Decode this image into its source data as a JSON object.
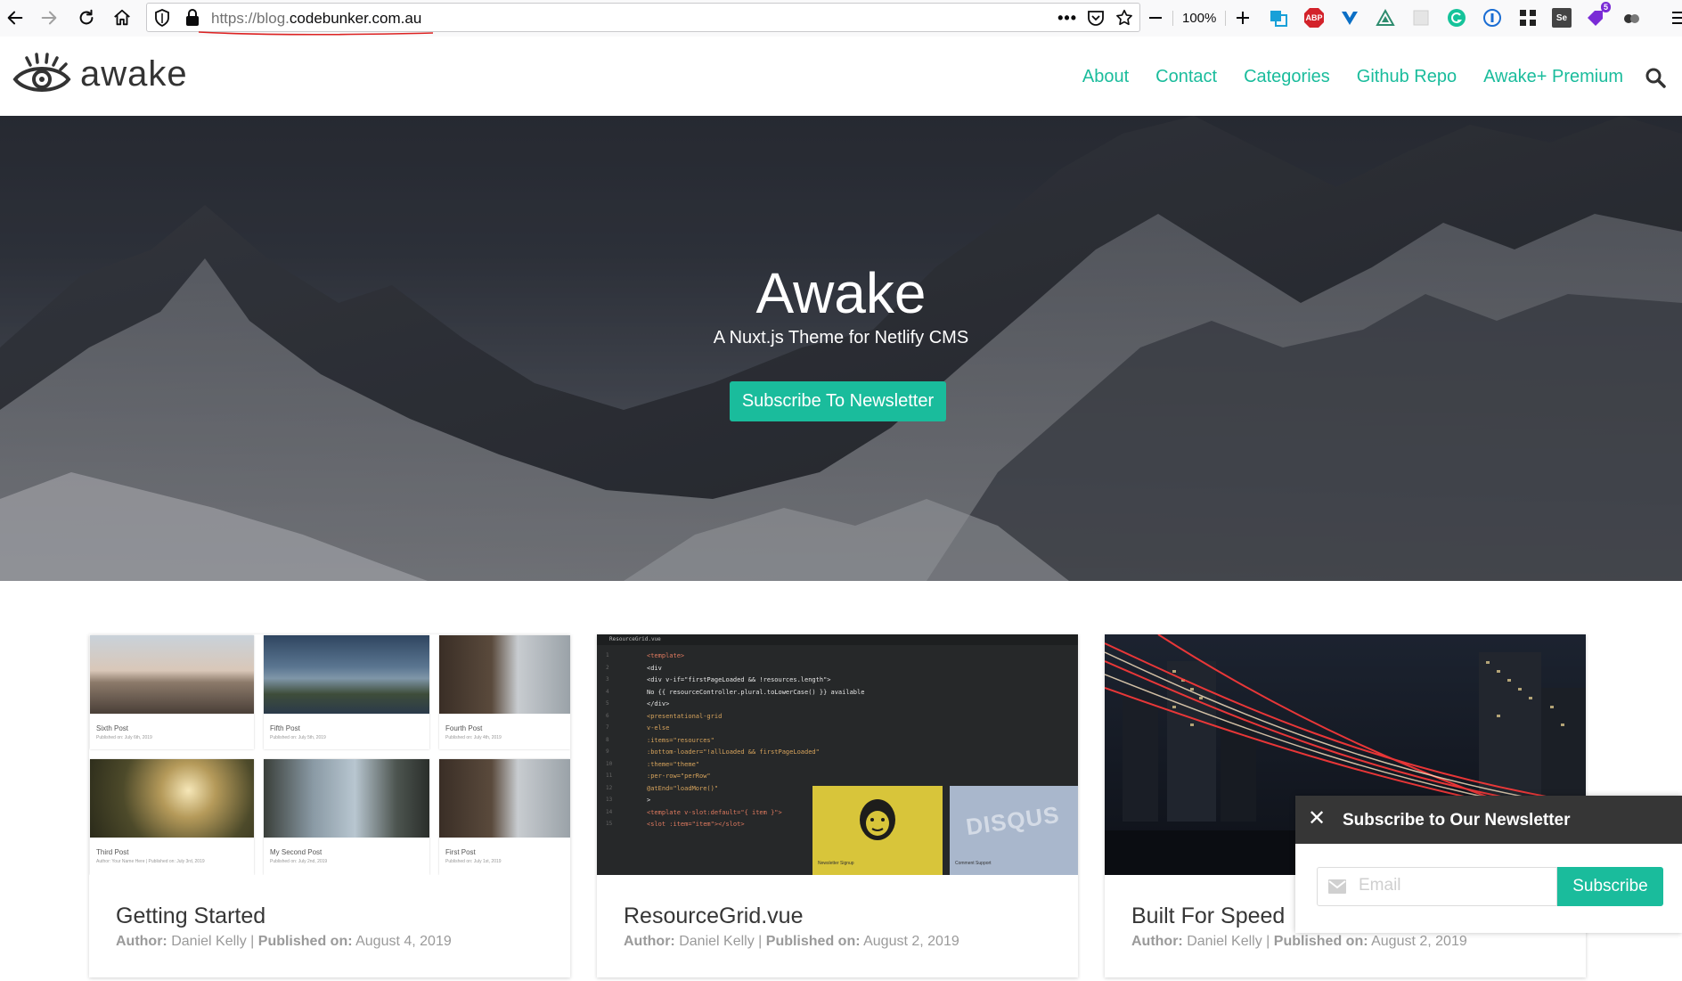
{
  "browser": {
    "url_protocol": "https://",
    "url_host_prefix": "blog.",
    "url_domain": "codebunker.com.au",
    "zoom": "100%",
    "ext_abp": "ABP",
    "ext_badge": "5",
    "ext_se": "Se"
  },
  "site": {
    "logo_text": "awake",
    "nav": [
      "About",
      "Contact",
      "Categories",
      "Github Repo",
      "Awake+ Premium"
    ]
  },
  "hero": {
    "title": "Awake",
    "subtitle": "A Nuxt.js Theme for Netlify CMS",
    "button": "Subscribe To Newsletter"
  },
  "cards": [
    {
      "title": "Getting Started",
      "author_label": "Author:",
      "author": "Daniel Kelly",
      "sep": "|",
      "published_label": "Published on:",
      "date": "August 4, 2019",
      "thumbs": [
        {
          "title": "Sixth Post",
          "meta": "Published on: July 6th, 2019"
        },
        {
          "title": "Fifth Post",
          "meta": "Published on: July 5th, 2019"
        },
        {
          "title": "Fourth Post",
          "meta": "Published on: July 4th, 2019"
        },
        {
          "title": "Third Post",
          "meta": "Author: Your Name Here | Published on: July 3rd, 2019"
        },
        {
          "title": "My Second Post",
          "meta": "Published on: July 2nd, 2019"
        },
        {
          "title": "First Post",
          "meta": "Published on: July 1st, 2019"
        }
      ]
    },
    {
      "title": "ResourceGrid.vue",
      "author_label": "Author:",
      "author": "Daniel Kelly",
      "sep": "|",
      "published_label": "Published on:",
      "date": "August 2, 2019",
      "editor_tab": "ResourceGrid.vue",
      "code_lines": [
        "<template>",
        "  <div",
        "    <div v-if=\"firstPageLoaded && !resources.length\">",
        "      No {{ resourceController.plural.toLowerCase() }} available",
        "    </div>",
        "    <presentational-grid",
        "      v-else",
        "      :items=\"resources\"",
        "      :bottom-loader=\"!allLoaded && firstPageLoaded\"",
        "      :theme=\"theme\"",
        "      :per-row=\"perRow\"",
        "      @atEnd=\"loadMore()\"",
        "    >",
        "      <template v-slot:default=\"{ item }\">",
        "        <slot :item=\"item\"></slot>"
      ],
      "tile_a_label": "Newsletter Signup",
      "tile_b_label": "Comment Support",
      "tile_b_logo": "DISQUS"
    },
    {
      "title": "Built For Speed",
      "author_label": "Author:",
      "author": "Daniel Kelly",
      "sep": "|",
      "published_label": "Published on:",
      "date": "August 2, 2019"
    }
  ],
  "popup": {
    "close": "✕",
    "title": "Subscribe to Our Newsletter",
    "email_placeholder": "Email",
    "email_value": "",
    "submit": "Subscribe"
  },
  "colors": {
    "accent": "#1abc9c",
    "dark": "#363636"
  }
}
